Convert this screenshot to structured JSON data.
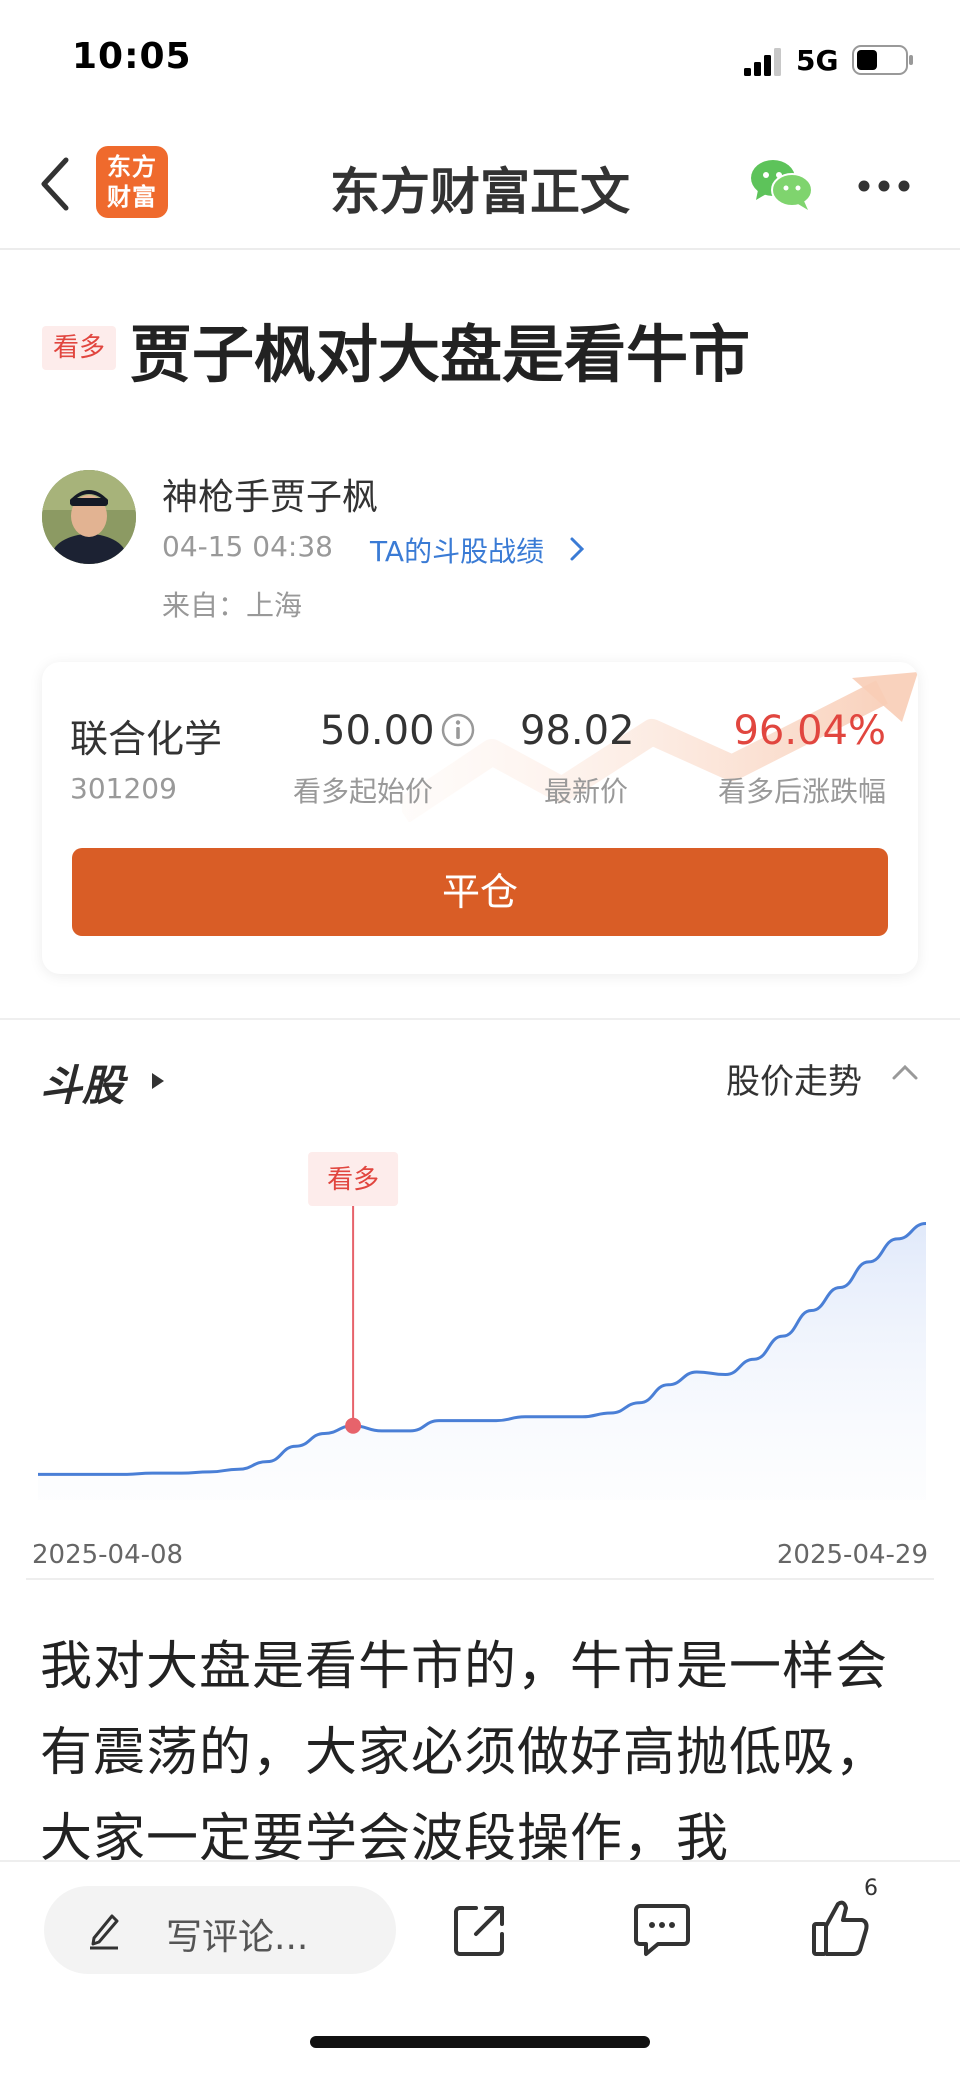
{
  "status_bar": {
    "time": "10:05",
    "network": "5G"
  },
  "nav": {
    "logo_line1": "东方",
    "logo_line2": "财富",
    "title": "东方财富正文"
  },
  "article": {
    "tag": "看多",
    "title": "贾子枫对大盘是看牛市",
    "author": "神枪手贾子枫",
    "time": "04-15 04:38",
    "record_link": "TA的斗股战绩",
    "origin": "来自：上海",
    "body": "我对大盘是看牛市的，牛市是一样会有震荡的，大家必须做好高抛低吸，大家一定要学会波段操作，我"
  },
  "stock_card": {
    "name": "联合化学",
    "code": "301209",
    "start_price": "50.00",
    "start_label": "看多起始价",
    "latest_price": "98.02",
    "latest_label": "最新价",
    "change": "96.04%",
    "change_label": "看多后涨跌幅",
    "button": "平仓",
    "accent_color": "#d95d26",
    "up_color": "#e1463f"
  },
  "doug_section": {
    "logo_text": "斗股",
    "trend_label": "股价走势",
    "marker_label": "看多"
  },
  "chart_data": {
    "type": "area",
    "x_start_label": "2025-04-08",
    "x_end_label": "2025-04-29",
    "x": [
      0,
      1,
      2,
      3,
      4,
      5,
      6,
      7,
      8,
      9,
      10,
      11,
      12,
      13,
      14,
      15,
      16,
      17,
      18,
      19,
      20,
      21,
      22,
      23,
      24,
      25,
      26,
      27,
      28,
      29,
      30,
      31
    ],
    "values": [
      50,
      50,
      50,
      50,
      50.5,
      50.5,
      51,
      52,
      55,
      61,
      66,
      69,
      67,
      67,
      71,
      71,
      71,
      72.5,
      72.5,
      72.5,
      74,
      78,
      85,
      90,
      89,
      95,
      104,
      114,
      123,
      133,
      142,
      148
    ],
    "ylim": [
      40,
      165
    ],
    "marker_index": 11,
    "line_color": "#4a7fd6",
    "marker_color": "#e7636b"
  },
  "bottom_bar": {
    "comment_placeholder": "写评论...",
    "like_count": "6"
  }
}
